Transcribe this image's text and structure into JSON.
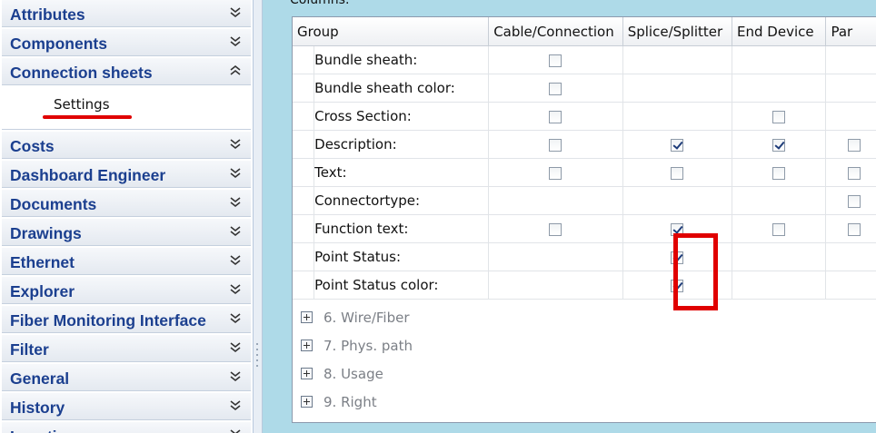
{
  "sidebar": {
    "categories_top": [
      {
        "label": "Attributes",
        "expanded": false
      },
      {
        "label": "Components",
        "expanded": false
      },
      {
        "label": "Connection sheets",
        "expanded": true
      }
    ],
    "sub_items": [
      {
        "label": "Settings",
        "selected": true
      }
    ],
    "categories_bottom": [
      {
        "label": "Costs",
        "expanded": false
      },
      {
        "label": "Dashboard Engineer",
        "expanded": false
      },
      {
        "label": "Documents",
        "expanded": false
      },
      {
        "label": "Drawings",
        "expanded": false
      },
      {
        "label": "Ethernet",
        "expanded": false
      },
      {
        "label": "Explorer",
        "expanded": false
      },
      {
        "label": "Fiber Monitoring Interface",
        "expanded": false
      },
      {
        "label": "Filter",
        "expanded": false
      },
      {
        "label": "General",
        "expanded": false
      },
      {
        "label": "History",
        "expanded": false
      },
      {
        "label": "Locations",
        "expanded": false
      }
    ]
  },
  "main": {
    "columns_label": "Columns:",
    "table": {
      "headers": [
        "Group",
        "Cable/Connection",
        "Splice/Splitter",
        "End Device",
        "Par"
      ],
      "rows": [
        {
          "name": "Bundle sheath:",
          "cells": [
            "unchecked",
            null,
            null,
            null
          ]
        },
        {
          "name": "Bundle sheath color:",
          "cells": [
            "unchecked",
            null,
            null,
            null
          ]
        },
        {
          "name": "Cross Section:",
          "cells": [
            "unchecked",
            null,
            "unchecked",
            null
          ]
        },
        {
          "name": "Description:",
          "cells": [
            "unchecked",
            "checked",
            "checked",
            "unchecked"
          ]
        },
        {
          "name": "Text:",
          "cells": [
            "unchecked",
            "unchecked",
            "unchecked",
            "unchecked"
          ]
        },
        {
          "name": "Connectortype:",
          "cells": [
            null,
            null,
            null,
            "unchecked"
          ]
        },
        {
          "name": "Function text:",
          "cells": [
            "unchecked",
            "checked",
            "unchecked",
            "unchecked"
          ]
        },
        {
          "name": "Point Status:",
          "cells": [
            null,
            "checked",
            null,
            null
          ]
        },
        {
          "name": "Point Status color:",
          "cells": [
            null,
            "checked",
            null,
            null
          ]
        }
      ]
    },
    "collapsed_groups": [
      "6. Wire/Fiber",
      "7. Phys. path",
      "8. Usage",
      "9. Right"
    ]
  },
  "colors": {
    "sidebar_text": "#1b3f8f",
    "main_background": "#aedae8",
    "annotation_red": "#e00000"
  }
}
